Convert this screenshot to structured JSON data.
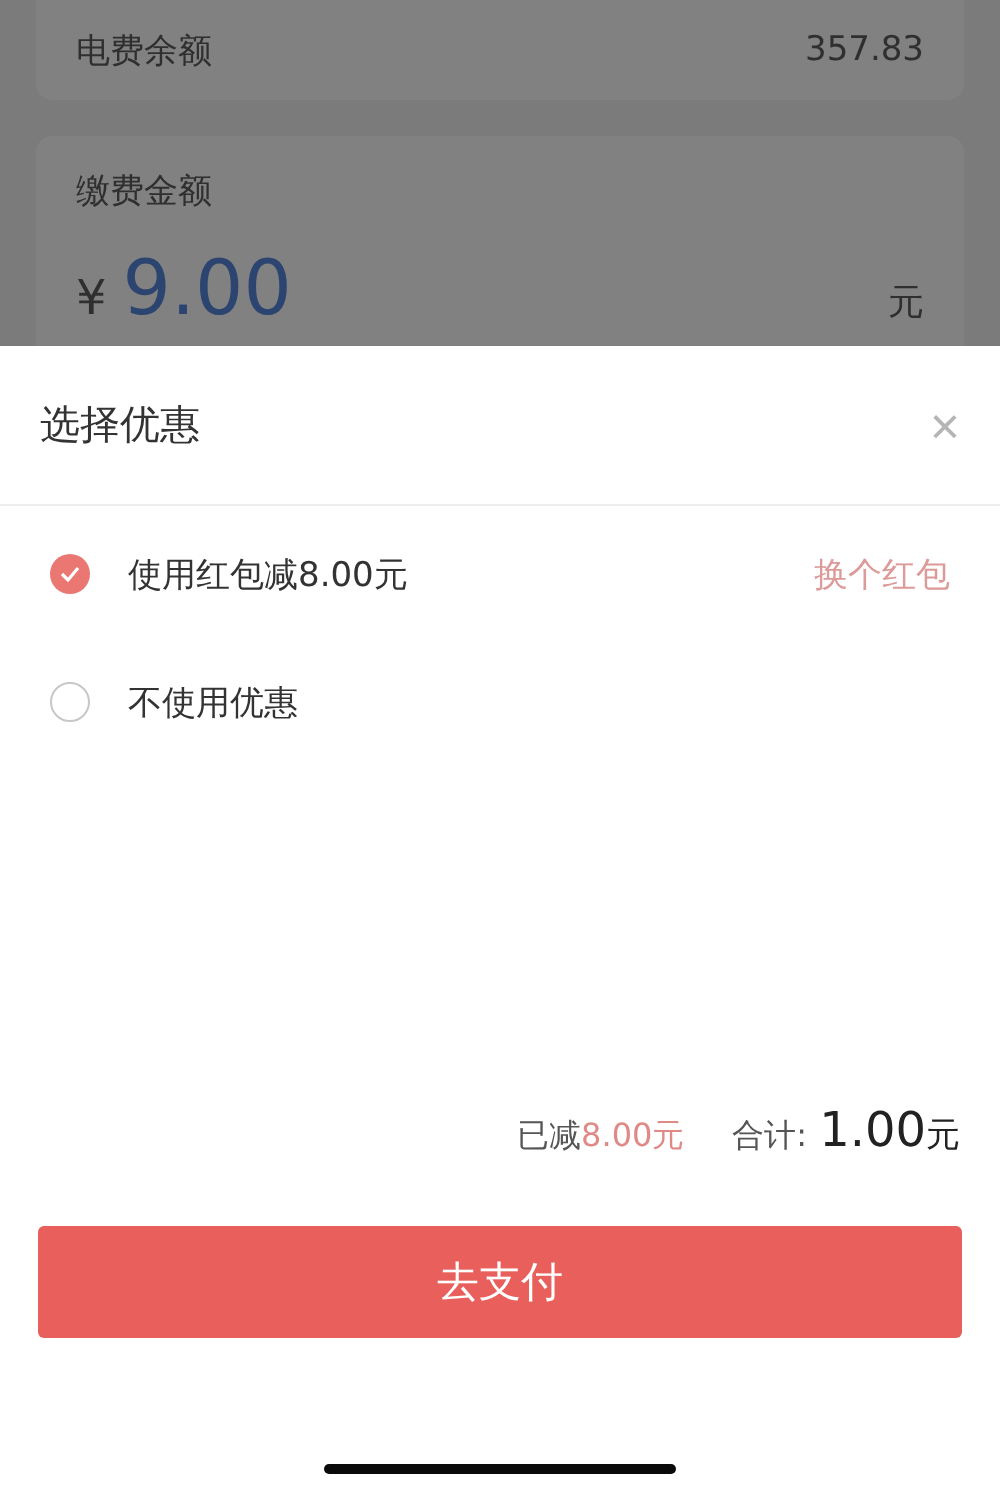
{
  "background": {
    "balance_label": "电费余额",
    "balance_value": "357.83",
    "amount_label": "缴费金额",
    "currency": "¥",
    "amount": "9.00",
    "unit": "元"
  },
  "sheet": {
    "title": "选择优惠",
    "close": "×",
    "options": [
      {
        "label": "使用红包减8.00元",
        "selected": true,
        "action": "换个红包"
      },
      {
        "label": "不使用优惠",
        "selected": false
      }
    ],
    "discount_label": "已减",
    "discount_value": "8.00元",
    "total_label": "合计:",
    "total_value": "1.00",
    "total_unit": "元",
    "pay_button": "去支付"
  }
}
